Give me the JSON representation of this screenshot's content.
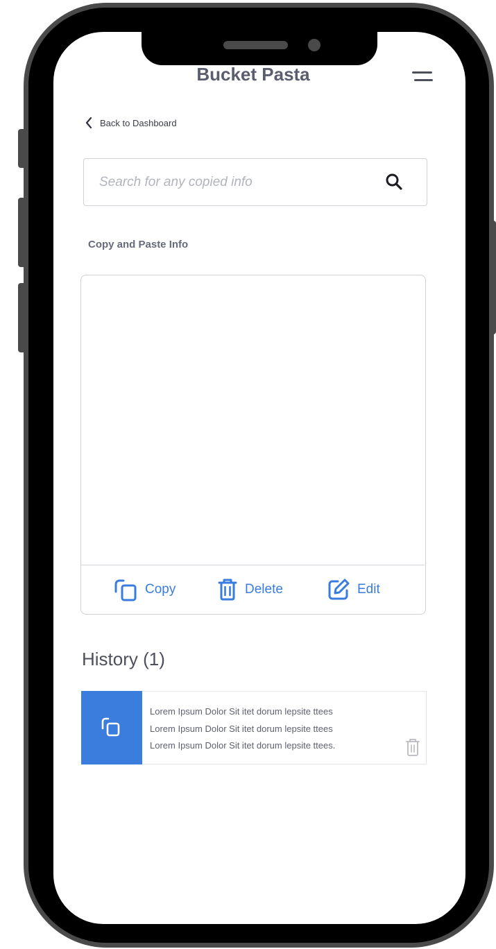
{
  "header": {
    "app_title": "Bucket Pasta"
  },
  "nav": {
    "back_label": "Back to Dashboard"
  },
  "search": {
    "placeholder": "Search for any copied info",
    "value": ""
  },
  "paste_section": {
    "label": "Copy and Paste Info",
    "content": "",
    "actions": {
      "copy_label": "Copy",
      "delete_label": "Delete",
      "edit_label": "Edit"
    }
  },
  "history": {
    "title": "History (1)",
    "items": [
      {
        "lines": [
          "Lorem Ipsum Dolor Sit itet dorum lepsite ttees",
          "Lorem Ipsum Dolor Sit itet dorum lepsite ttees",
          "Lorem Ipsum Dolor Sit itet dorum lepsite ttees."
        ]
      }
    ]
  },
  "colors": {
    "accent": "#3b7ddd",
    "title_text": "#5a5d6e",
    "frame": "#4a4a4a"
  },
  "icons": [
    "menu-icon",
    "chevron-left-icon",
    "search-icon",
    "copy-icon",
    "trash-icon",
    "edit-icon"
  ]
}
